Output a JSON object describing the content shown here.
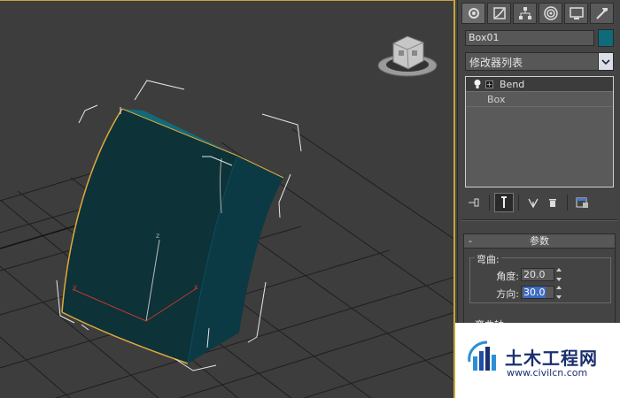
{
  "viewport": {
    "axis_labels": {
      "x": "x",
      "y": "y",
      "z": "z"
    },
    "colors": {
      "object_front": "#0d3238",
      "object_side": "#0b3a44",
      "object_top": "#116a7b",
      "edge": "#e2a93a",
      "grid": "#1f1f1f"
    }
  },
  "panel": {
    "tabs": [
      {
        "icon": "create-icon",
        "active": true
      },
      {
        "icon": "modify-icon",
        "active": false
      },
      {
        "icon": "hierarchy-icon",
        "active": false
      },
      {
        "icon": "motion-icon",
        "active": false
      },
      {
        "icon": "display-icon",
        "active": false
      },
      {
        "icon": "utilities-icon",
        "active": false
      }
    ],
    "object_name": "Box01",
    "object_color": "#0f6b7a",
    "modifier_list_label": "修改器列表",
    "stack": [
      {
        "label": "Bend",
        "selected": true
      },
      {
        "label": "Box",
        "selected": false
      }
    ],
    "rollout_title": "参数",
    "rollout_toggle": "-",
    "bend_group_label": "弯曲:",
    "angle": {
      "label": "角度:",
      "value": "20.0"
    },
    "direction": {
      "label": "方向:",
      "value": "30.0"
    },
    "bend_axis_label": "弯曲轴:"
  },
  "watermark": {
    "title": "土木工程网",
    "url": "www.civilcn.com"
  }
}
